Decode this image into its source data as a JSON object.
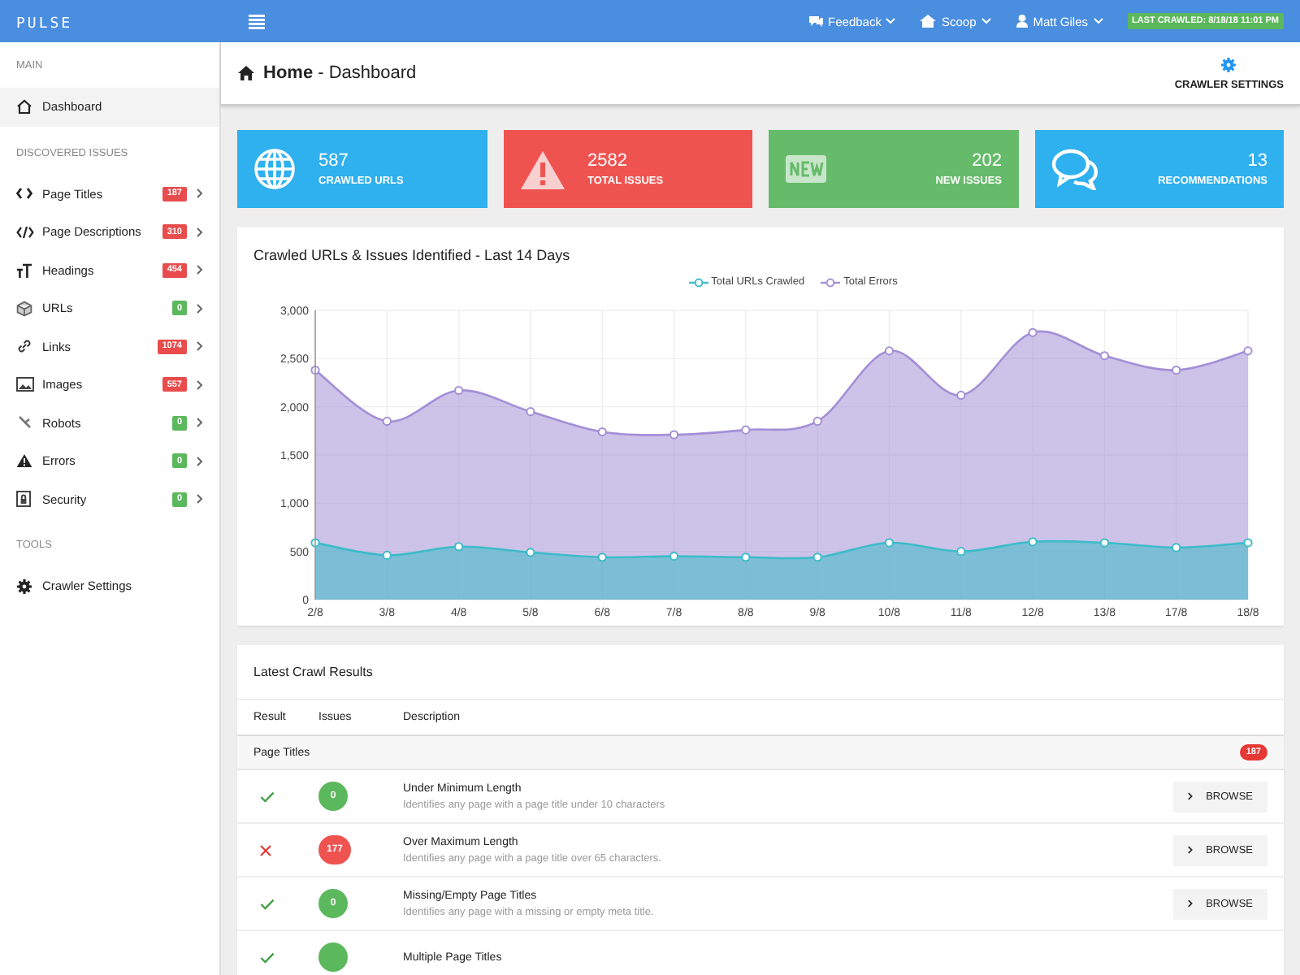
{
  "topbar": {
    "logo": "PULSE",
    "menus": [
      {
        "label": "Feedback"
      },
      {
        "label": "Scoop"
      },
      {
        "label": "Matt Giles"
      }
    ],
    "last_crawled": "LAST CRAWLED: 8/18/18 11:01 PM"
  },
  "sidebar": {
    "sections": [
      {
        "title": "MAIN",
        "items": [
          {
            "label": "Dashboard",
            "selected": true
          }
        ]
      },
      {
        "title": "DISCOVERED ISSUES",
        "items": [
          {
            "label": "Page Titles",
            "badge": "187",
            "color": "#e84c4c",
            "selected": false
          },
          {
            "label": "Page Descriptions",
            "badge": "310",
            "color": "#e84c4c",
            "selected": false
          },
          {
            "label": "Headings",
            "badge": "454",
            "color": "#e84c4c",
            "selected": false
          },
          {
            "label": "URLs",
            "badge": "0",
            "color": "#5cb85c",
            "selected": false
          },
          {
            "label": "Links",
            "badge": "1074",
            "color": "#e84c4c",
            "selected": false
          },
          {
            "label": "Images",
            "badge": "557",
            "color": "#e84c4c",
            "selected": false
          },
          {
            "label": "Robots",
            "badge": "0",
            "color": "#5cb85c",
            "selected": false
          },
          {
            "label": "Errors",
            "badge": "0",
            "color": "#5cb85c",
            "selected": false
          },
          {
            "label": "Security",
            "badge": "0",
            "color": "#5cb85c",
            "selected": false
          }
        ]
      },
      {
        "title": "TOOLS",
        "items": [
          {
            "label": "Crawler Settings",
            "selected": false
          }
        ]
      }
    ]
  },
  "header": {
    "title": "**Home** - Dashboard",
    "action": "CRAWLER SETTINGS"
  },
  "stats": [
    {
      "value": "587",
      "label": "CRAWLED URLS",
      "color": "#2fb0ef"
    },
    {
      "value": "2582",
      "label": "TOTAL ISSUES",
      "color": "#ef5350"
    },
    {
      "value": "202",
      "label": "NEW ISSUES",
      "color": "#66bb6a"
    },
    {
      "value": "13",
      "label": "RECOMMENDATIONS",
      "color": "#2fb0ef"
    }
  ],
  "chart_card": {
    "title": "Crawled URLs & Issues Identified - Last 14 Days",
    "chart_data": {
      "type": "area",
      "categories": [
        "2/8",
        "3/8",
        "4/8",
        "5/8",
        "6/8",
        "7/8",
        "8/8",
        "9/8",
        "10/8",
        "11/8",
        "12/8",
        "13/8",
        "17/8",
        "18/8"
      ],
      "ylim": [
        0,
        3000
      ],
      "yticks": [
        {
          "value": 0,
          "label": "0"
        },
        {
          "value": 500,
          "label": "500"
        },
        {
          "value": 1000,
          "label": "1,000"
        },
        {
          "value": 1500,
          "label": "1,500"
        },
        {
          "value": 2000,
          "label": "2,000"
        },
        {
          "value": 2500,
          "label": "2,500"
        },
        {
          "value": 3000,
          "label": "3,000"
        }
      ],
      "stacked": false,
      "grid": true,
      "series": [
        {
          "name": "Total URLs Crawled",
          "color": "#3cbcc8",
          "values": [
            590,
            460,
            550,
            490,
            440,
            450,
            440,
            440,
            590,
            500,
            600,
            590,
            540,
            590
          ]
        },
        {
          "name": "Total Errors",
          "color": "#a48fd6",
          "values": [
            2380,
            1850,
            2170,
            1950,
            1740,
            1710,
            1760,
            1850,
            2580,
            2120,
            2770,
            2530,
            2380,
            2580
          ]
        }
      ]
    }
  },
  "results": {
    "title": "Latest Crawl Results",
    "columns": [
      "Result",
      "Issues",
      "Description"
    ],
    "groups": [
      {
        "name": "Page Titles",
        "count": "187",
        "rows": [
          {
            "passed": true,
            "issues": "0",
            "title": "Under Minimum Length",
            "description": "Identifies any page with a page title under 10 characters",
            "button": "BROWSE"
          },
          {
            "passed": false,
            "issues": "177",
            "title": "Over Maximum Length",
            "description": "Identifies any page with a page title over 65 characters.",
            "button": "BROWSE"
          },
          {
            "passed": true,
            "issues": "0",
            "title": "Missing/Empty Page Titles",
            "description": "Identifies any page with a missing or empty meta title.",
            "button": "BROWSE"
          },
          {
            "passed": true,
            "title": "Multiple Page Titles"
          }
        ]
      }
    ]
  }
}
